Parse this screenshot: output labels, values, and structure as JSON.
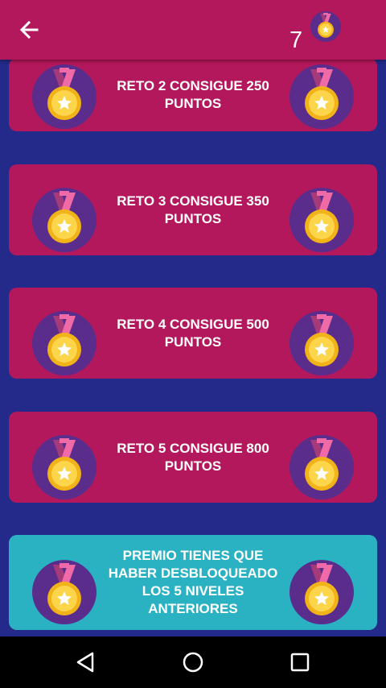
{
  "header": {
    "back_icon": "arrow-left-icon",
    "medal_count": "7",
    "medal_icon": "medal-icon"
  },
  "challenges": [
    {
      "label": "RETO 2  CONSIGUE 250 PUNTOS",
      "color": "#b3185c"
    },
    {
      "label": "RETO 3  CONSIGUE 350 PUNTOS",
      "color": "#b3185c"
    },
    {
      "label": "RETO 4  CONSIGUE 500 PUNTOS",
      "color": "#b3185c"
    },
    {
      "label": "RETO 5  CONSIGUE 800 PUNTOS",
      "color": "#b3185c"
    },
    {
      "label": "PREMIO  TIENES QUE HABER DESBLOQUEADO LOS 5 NIVELES ANTERIORES",
      "color": "#2bb2c2"
    }
  ],
  "navbar": {
    "back_icon": "nav-back-icon",
    "home_icon": "nav-home-icon",
    "recents_icon": "nav-recents-icon"
  },
  "colors": {
    "primary": "#b3185c",
    "background": "#232a8a",
    "prize": "#2bb2c2"
  }
}
